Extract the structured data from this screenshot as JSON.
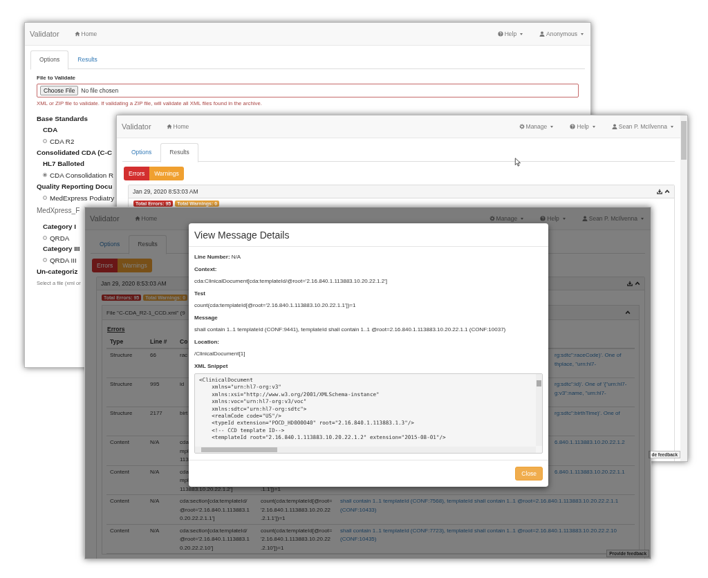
{
  "windows": [
    {
      "kind": "options",
      "navbar": {
        "brand": "Validator",
        "home": "Home",
        "menus": [
          {
            "kind": "help",
            "label": "Help"
          },
          {
            "kind": "user",
            "label": "Anonymous"
          }
        ]
      },
      "tabs": [
        {
          "label": "Options",
          "selected": true
        },
        {
          "label": "Results",
          "selected": false
        }
      ],
      "file_field": {
        "label": "File to Validate",
        "button": "Choose File",
        "value": "No file chosen",
        "invalid": true,
        "hint": "XML or ZIP file to validate. If validating a ZIP file, will validate all XML files found in the archive."
      },
      "standards": [
        {
          "kind": "heading",
          "text": "Base Standards"
        },
        {
          "kind": "subheading",
          "text": "CDA"
        },
        {
          "kind": "radio",
          "text": "CDA R2",
          "selected": false
        },
        {
          "kind": "heading",
          "text": "Consolidated CDA (C-C"
        },
        {
          "kind": "subheading",
          "text": "HL7 Balloted"
        },
        {
          "kind": "radio",
          "text": "CDA Consolidation R",
          "selected": true
        },
        {
          "kind": "heading",
          "text": "Quality Reporting Docu"
        },
        {
          "kind": "radio",
          "text": "MedExpress Podiatry",
          "selected": false
        },
        {
          "kind": "plain",
          "text": "MedXpress_F"
        },
        {
          "kind": "subheading",
          "text": "Category I"
        },
        {
          "kind": "radio",
          "text": "QRDA",
          "selected": false
        },
        {
          "kind": "subheading",
          "text": "Category III"
        },
        {
          "kind": "radio",
          "text": "QRDA III",
          "selected": false
        },
        {
          "kind": "heading",
          "text": "Un-categoriz"
        },
        {
          "kind": "note",
          "text": "Select a file (xml or"
        }
      ]
    },
    {
      "kind": "results",
      "navbar": {
        "brand": "Validator",
        "home": "Home",
        "menus": [
          {
            "kind": "manage",
            "label": "Manage"
          },
          {
            "kind": "help",
            "label": "Help"
          },
          {
            "kind": "user",
            "label": "Sean P. McIlvenna"
          }
        ]
      },
      "tabs": [
        {
          "label": "Options",
          "selected": false
        },
        {
          "label": "Results",
          "selected": true
        }
      ],
      "filters": [
        {
          "kind": "errors",
          "label": "Errors"
        },
        {
          "kind": "warnings",
          "label": "Warnings"
        }
      ],
      "timestamp": "Jan 29, 2020 8:53:03 AM",
      "badges": [
        {
          "kind": "errors",
          "label": "Total Errors: 95"
        },
        {
          "kind": "warnings",
          "label": "Total Warnings: 0"
        }
      ],
      "feedback": "de feedback"
    },
    {
      "kind": "results",
      "navbar": {
        "brand": "Validator",
        "home": "Home",
        "menus": [
          {
            "kind": "manage",
            "label": "Manage"
          },
          {
            "kind": "help",
            "label": "Help"
          },
          {
            "kind": "user",
            "label": "Sean P. McIlvenna"
          }
        ]
      },
      "tabs": [
        {
          "label": "Options",
          "selected": false
        },
        {
          "label": "Results",
          "selected": true
        }
      ],
      "filters": [
        {
          "kind": "errors",
          "label": "Errors"
        },
        {
          "kind": "warnings",
          "label": "Warnings"
        }
      ],
      "timestamp": "Jan 29, 2020 8:53:03 AM",
      "badges": [
        {
          "kind": "errors",
          "label": "Total Errors: 95"
        },
        {
          "kind": "warnings",
          "label": "Total Warnings: 0"
        }
      ],
      "file_panel": {
        "title": "File \"C-CDA_R2-1_CCD.xml\" (9",
        "table_title": "Errors",
        "columns": [
          "Type",
          "Line #",
          "Co"
        ],
        "rows": [
          {
            "type": "Structure",
            "line": "66",
            "context": "rac",
            "message": "rg:sdtc\":raceCode)'. One of\nthplace, \"urn:hl7-"
          },
          {
            "type": "Structure",
            "line": "995",
            "context": "id",
            "message": "rg:sdtc\":id)'. One of '{\"urn:hl7-\ng:v3\":name, \"urn:hl7-"
          },
          {
            "type": "Structure",
            "line": "2177",
            "context": "birt",
            "message": "rg:sdtc\":birthTime)'. One of"
          },
          {
            "type": "Content",
            "line": "N/A",
            "context": "cda\nmpl\n113",
            "message": "6.840.1.113883.10.20.22.1.2"
          },
          {
            "type": "Content",
            "line": "N/A",
            "context": "cda\nmpl\n113883.10.20.22.1.2']",
            "test_tail": ".1.1'])=1",
            "message": "6.840.1.113883.10.20.22.1.1"
          },
          {
            "type": "Content",
            "line": "N/A",
            "context": "cda:section[cda:templateId/\n@root='2.16.840.1.113883.1\n0.20.22.2.1.1']",
            "test": "count(cda:templateId[@root=\n'2.16.840.1.113883.10.20.22\n.2.1.1'])=1",
            "message": "shall contain 1..1 templateId (CONF:7568), templateId shall contain 1..1 @root=2.16.840.1.113883.10.20.22.2.1.1\n(CONF:10433)"
          },
          {
            "type": "Content",
            "line": "N/A",
            "context": "cda:section[cda:templateId/\n@root='2.16.840.1.113883.1\n0.20.22.2.10']",
            "test": "count(cda:templateId[@root=\n'2.16.840.1.113883.10.20.22\n.2.10'])=1",
            "message": "shall contain 1..1 templateId (CONF:7723), templateId shall contain 1..1 @root=2.16.840.1.113883.10.20.22.2.10\n(CONF:10435)"
          }
        ]
      },
      "feedback": "Provide feedback",
      "modal": {
        "title": "View Message Details",
        "fields": [
          {
            "kind": "inline",
            "text": "**Line Number:** N/A"
          },
          {
            "kind": "block",
            "label": "Context:",
            "value": "cda:ClinicalDocument[cda:templateId/@root='2.16.840.1.113883.10.20.22.1.2']"
          },
          {
            "kind": "block",
            "label": "Test",
            "value": "count(cda:templateId[@root='2.16.840.1.113883.10.20.22.1.1'])=1"
          },
          {
            "kind": "block",
            "label": "Message",
            "value": "shall contain 1..1 templateId (CONF:9441), templateId shall contain 1..1 @root=2.16.840.1.113883.10.20.22.1.1 (CONF:10037)"
          },
          {
            "kind": "block",
            "label": "Location:",
            "value": "/ClinicalDocument[1]"
          },
          {
            "kind": "code",
            "label": "XML Snippet",
            "lines": [
              "<ClinicalDocument",
              "    xmlns=\"urn:hl7-org:v3\"",
              "    xmlns:xsi=\"http://www.w3.org/2001/XMLSchema-instance\"",
              "    xmlns:voc=\"urn:hl7-org:v3/voc\"",
              "    xmlns:sdtc=\"urn:hl7-org:sdtc\">",
              "    <realmCode code=\"US\"/>",
              "    <typeId extension=\"POCD_HD000040\" root=\"2.16.840.1.113883.1.3\"/>",
              "    <!-- CCD template ID-->",
              "    <templateId root=\"2.16.840.1.113883.10.20.22.1.2\" extension=\"2015-08-01\"/>"
            ]
          }
        ],
        "button": "Close"
      }
    }
  ]
}
